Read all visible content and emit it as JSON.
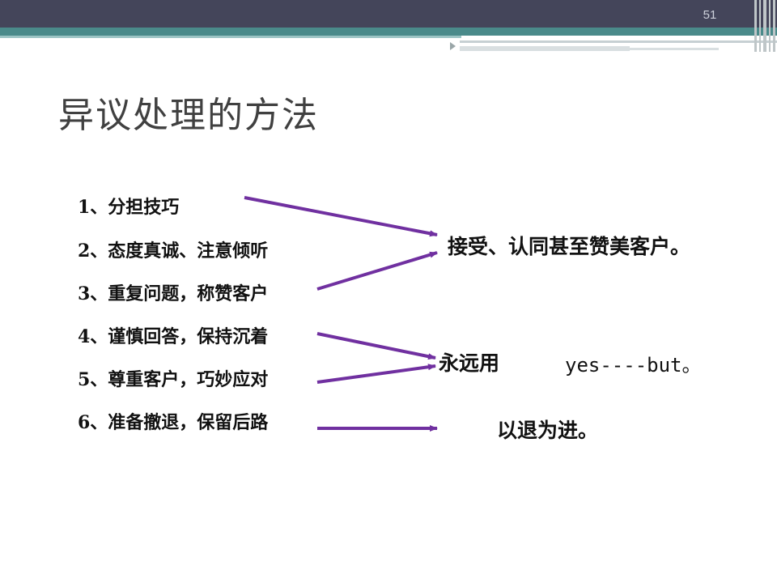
{
  "slide": {
    "page_number": "51",
    "title": "异议处理的方法",
    "items": [
      "1、分担技巧",
      "2、态度真诚、注意倾听",
      "3、重复问题，称赞客户",
      "4、谨慎回答，保持沉着",
      "5、尊重客户，巧妙应对",
      "6、准备撤退，保留后路"
    ],
    "results": {
      "accept": "接受、认同甚至赞美客户。",
      "always_prefix": "永远用",
      "always_phrase": "yes----but。",
      "retreat": "以退为进。"
    },
    "colors": {
      "arrow": "#7030a0",
      "header_bar": "#44455a",
      "teal_band": "#4a8a8a"
    }
  }
}
